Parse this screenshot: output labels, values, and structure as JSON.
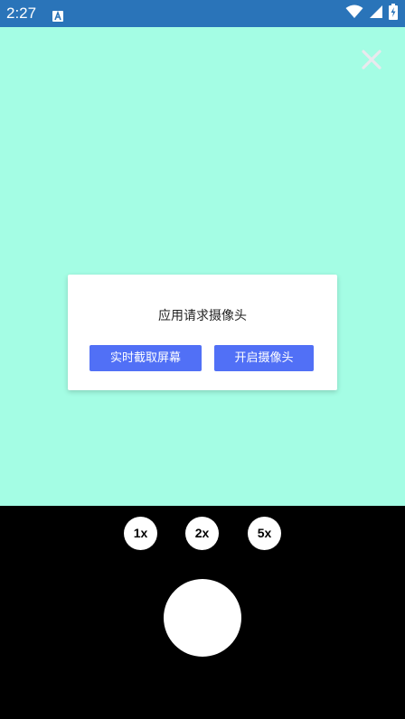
{
  "status_bar": {
    "time": "2:27",
    "app_icon": "a-notification-icon",
    "icons": [
      "wifi-icon",
      "cell-signal-icon",
      "battery-charging-icon"
    ],
    "background": "#2a74b9"
  },
  "preview": {
    "background": "#a4fde4",
    "close_icon": "close-icon"
  },
  "dialog": {
    "title": "应用请求摄像头",
    "buttons": {
      "screen_capture": "实时截取屏幕",
      "open_camera": "开启摄像头"
    },
    "button_color": "#5170f6"
  },
  "controls": {
    "zoom_options": [
      "1x",
      "2x",
      "5x"
    ],
    "shutter": "shutter-button"
  }
}
